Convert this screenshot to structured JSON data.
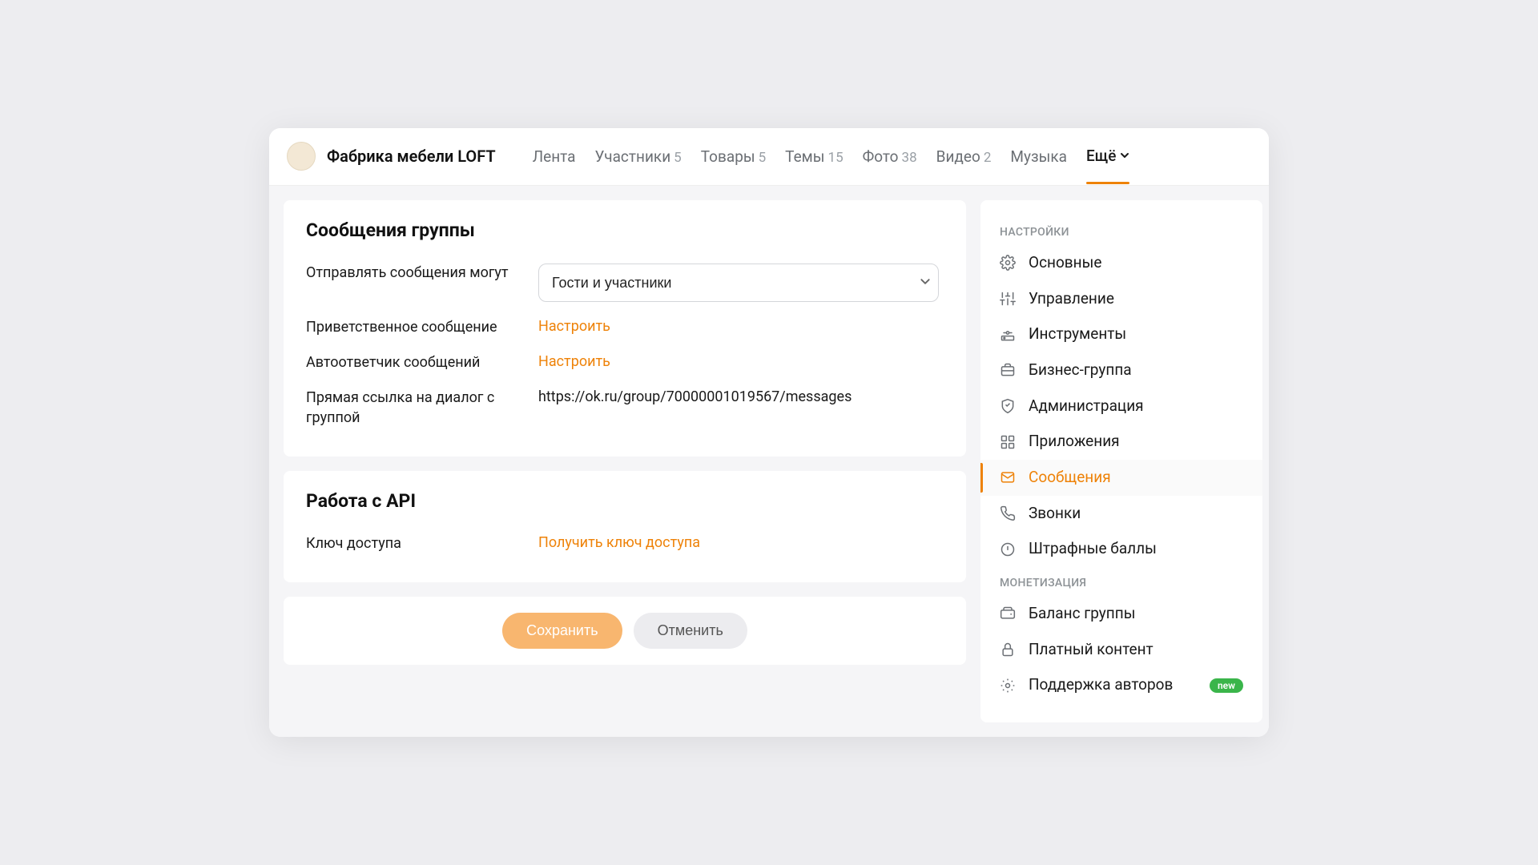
{
  "header": {
    "group_name": "Фабрика мебели LOFT",
    "tabs": [
      {
        "label": "Лента",
        "count": ""
      },
      {
        "label": "Участники",
        "count": "5"
      },
      {
        "label": "Товары",
        "count": "5"
      },
      {
        "label": "Темы",
        "count": "15"
      },
      {
        "label": "Фото",
        "count": "38"
      },
      {
        "label": "Видео",
        "count": "2"
      },
      {
        "label": "Музыка",
        "count": ""
      }
    ],
    "more_label": "Ещё"
  },
  "messages_card": {
    "title": "Сообщения группы",
    "who_can_send_label": "Отправлять сообщения могут",
    "who_can_send_value": "Гости и участники",
    "welcome_label": "Приветственное сообщение",
    "welcome_action": "Настроить",
    "autoresponder_label": "Автоответчик сообщений",
    "autoresponder_action": "Настроить",
    "direct_link_label": "Прямая ссылка на диалог с группой",
    "direct_link_value": "https://ok.ru/group/70000001019567/messages"
  },
  "api_card": {
    "title": "Работа с API",
    "access_key_label": "Ключ доступа",
    "access_key_action": "Получить ключ доступа"
  },
  "actions": {
    "save": "Сохранить",
    "cancel": "Отменить"
  },
  "sidebar": {
    "section1_title": "НАСТРОЙКИ",
    "section2_title": "МОНЕТИЗАЦИЯ",
    "items1": [
      {
        "label": "Основные"
      },
      {
        "label": "Управление"
      },
      {
        "label": "Инструменты"
      },
      {
        "label": "Бизнес-группа"
      },
      {
        "label": "Администрация"
      },
      {
        "label": "Приложения"
      },
      {
        "label": "Сообщения"
      },
      {
        "label": "Звонки"
      },
      {
        "label": "Штрафные баллы"
      }
    ],
    "items2": [
      {
        "label": "Баланс группы"
      },
      {
        "label": "Платный контент"
      },
      {
        "label": "Поддержка авторов"
      }
    ],
    "new_badge": "new"
  }
}
